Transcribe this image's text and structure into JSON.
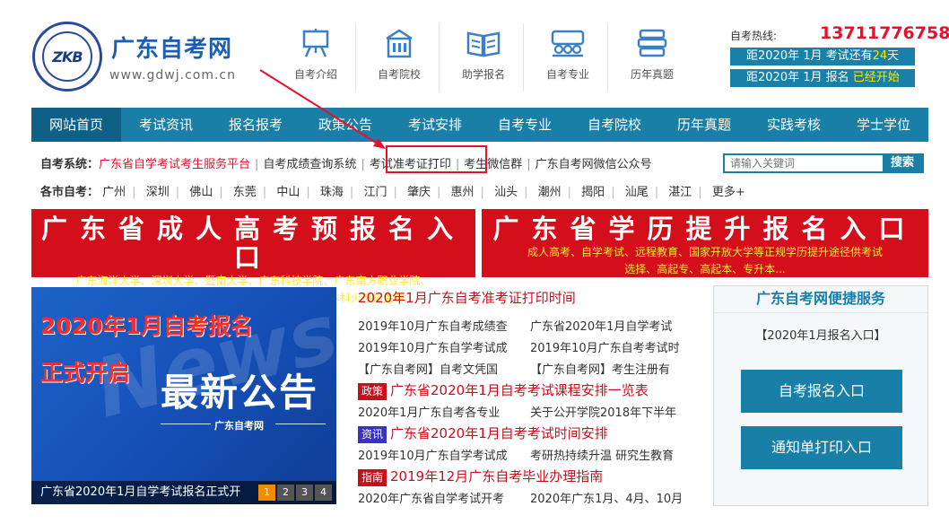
{
  "header": {
    "logo_text": "ZKB",
    "title": "广东自考网",
    "url": "www.gdwj.com.cn",
    "topnav": [
      {
        "label": "自考介绍",
        "icon": "easel-icon"
      },
      {
        "label": "自考院校",
        "icon": "building-icon"
      },
      {
        "label": "助学报名",
        "icon": "book-icon"
      },
      {
        "label": "自考专业",
        "icon": "people-icon"
      },
      {
        "label": "历年真题",
        "icon": "stack-icon"
      }
    ],
    "hotline_label": "自考热线:",
    "hotline_number": "13711776758",
    "countdown1": {
      "prefix": "距2020年 1月 考试还有",
      "value": "24",
      "suffix": "天"
    },
    "countdown2": {
      "prefix": "距2020年 1月 报名",
      "value": "已经开始"
    }
  },
  "nav": [
    "网站首页",
    "考试资讯",
    "报名报考",
    "政策公告",
    "考试安排",
    "自考专业",
    "自考院校",
    "历年真题",
    "实践考核",
    "学士学位"
  ],
  "system": {
    "label": "自考系统：",
    "items": [
      "广东省自学考试考生服务平台",
      "自考成绩查询系统",
      "考试准考证打印",
      "考生微信群",
      "广东自考网微信公众号"
    ]
  },
  "search": {
    "placeholder": "请输入关键词",
    "button": "搜索"
  },
  "cities": {
    "label": "各市自考：",
    "items": [
      "广州",
      "深圳",
      "佛山",
      "东莞",
      "中山",
      "珠海",
      "江门",
      "肇庆",
      "惠州",
      "汕头",
      "潮州",
      "揭阳",
      "汕尾",
      "湛江",
      "更多+"
    ]
  },
  "banners": [
    {
      "title": "广东省成人高考预报名入口",
      "sub1": "广东海洋大学、深圳大学、暨南大学、广东科技学院、广东南方职业学院、",
      "sub2": "广州华商职业学院、广东药科大学等院校成人专科/本科火热招生中...."
    },
    {
      "title": "广东省学历提升报名入口",
      "sub1": "成人高考、自学考试、远程教育、国家开放大学等正规学历提升途径供考试",
      "sub2": "选择、高起专、高起本、专升本..."
    }
  ],
  "slider": {
    "headline": "2020年1月自考报名",
    "subline": "正式开启",
    "big": "最新公告",
    "small": "广东自考网",
    "watermark": "News",
    "caption": "广东省2020年1月自学考试报名正式开",
    "pages": [
      "1",
      "2",
      "3",
      "4"
    ]
  },
  "news": {
    "top": "2020年1月广东自考准考证打印时间",
    "row1": [
      "2019年10月广东自考成绩查",
      "广东省2020年1月自学考试"
    ],
    "row2": [
      "2019年10月广东自学考试成",
      "2019年10月广东自考考试时"
    ],
    "row3": [
      "【广东自考网】自考文凭国",
      "【广东自考网】考生注册有"
    ],
    "h1": {
      "tag": "政策",
      "text": "广东省2020年1月自考考试课程安排一览表"
    },
    "row4": [
      "2020年1月广东自考各专业",
      "关于公开学院2018年下半年"
    ],
    "h2": {
      "tag": "资讯",
      "text": "广东省2020年1月自考考试时间安排"
    },
    "row5": [
      "2019年10月广东自学考试成",
      "考研热持续升温 研究生教育"
    ],
    "h3": {
      "tag": "指南",
      "text": "2019年12月广东自考毕业办理指南"
    },
    "row6": [
      "2020年广东省自学考试开考",
      "2020年广东1月、4月、10月"
    ]
  },
  "service": {
    "title": "广东自考网便捷服务",
    "link": "【2020年1月报名入口】",
    "btn1": "自考报名入口",
    "btn2": "通知单打印入口"
  },
  "colors": {
    "brand": "#1a7fa7",
    "red": "#e8112d",
    "banner": "#d40e1a"
  }
}
